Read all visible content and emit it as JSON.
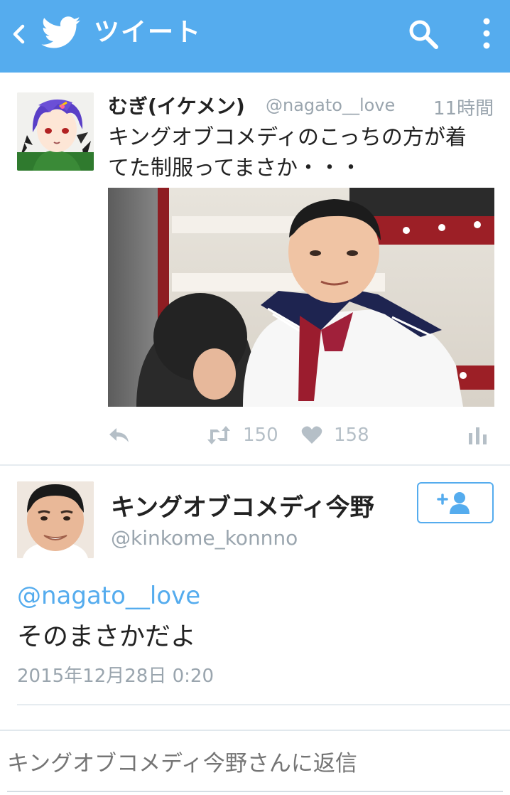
{
  "header": {
    "title": "ツイート",
    "background_color": "#55acee",
    "icons": [
      "back-icon",
      "twitter-bird-icon",
      "search-icon",
      "more-vertical-icon"
    ]
  },
  "tweet": {
    "display_name": "むぎ(イケメン)",
    "handle": "@nagato__love",
    "time": "11時間",
    "text_line1": "キングオブコメディのこっちの方が着",
    "text_line2": "てた制服ってまさか・・・",
    "actions": {
      "retweet_count": "150",
      "like_count": "158"
    }
  },
  "reply": {
    "display_name": "キングオブコメディ今野",
    "handle": "@kinkome_konnno",
    "mention": "@nagato__love",
    "text": "そのまさかだよ",
    "date": "2015年12月28日 0:20"
  },
  "composer": {
    "placeholder": "キングオブコメディ今野さんに返信"
  },
  "colors": {
    "accent": "#55acee",
    "muted_text": "#9aa5ae",
    "action_icon": "#b5bfc7"
  }
}
